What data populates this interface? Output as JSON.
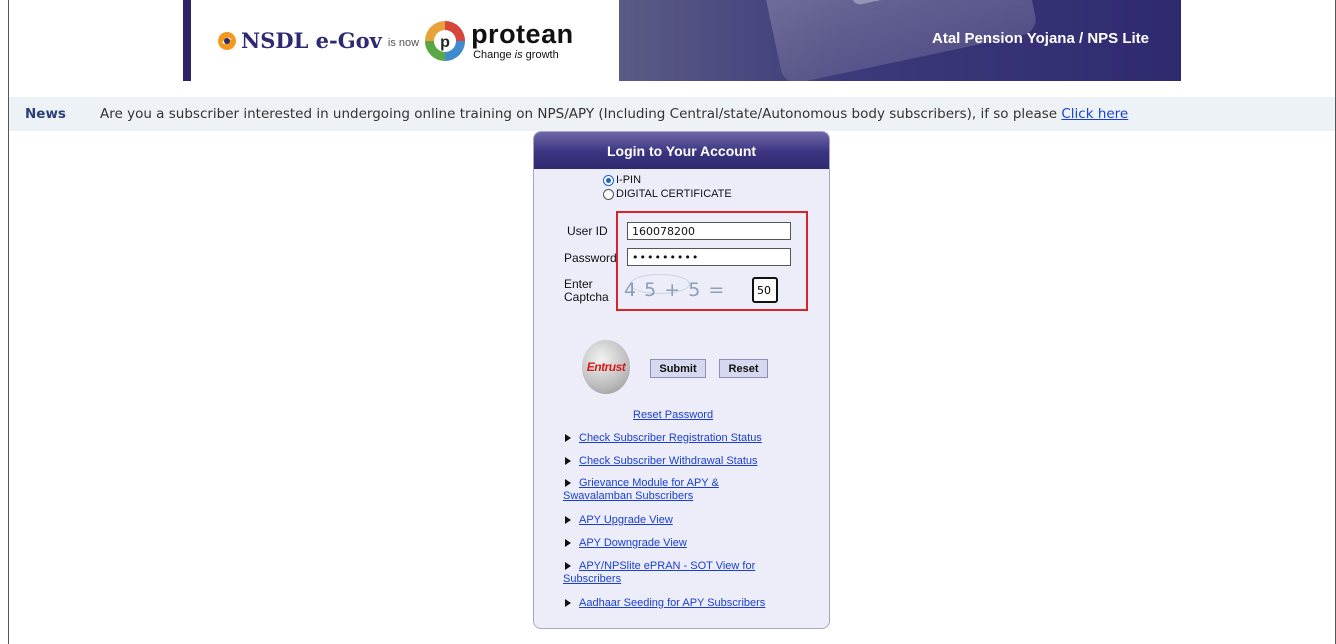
{
  "header": {
    "nsdl_logo_text": "NSDL e-Gov",
    "is_now_text": "is now",
    "protean_logo_text": "protean",
    "protean_tagline_pre": "Change ",
    "protean_tagline_italic": "is",
    "protean_tagline_post": " growth",
    "title": "Atal Pension Yojana / NPS Lite"
  },
  "news": {
    "label": "News",
    "text": "Are you a subscriber interested in undergoing online training on NPS/APY (Including Central/state/Autonomous body subscribers), if so please ",
    "link_text": "Click here"
  },
  "login": {
    "title": "Login to Your Account",
    "options": [
      {
        "label": "I-PIN",
        "selected": true
      },
      {
        "label": "DIGITAL CERTIFICATE",
        "selected": false
      }
    ],
    "user_id_label": "User ID",
    "user_id_value": "160078200",
    "password_label": "Password",
    "password_value": "•••••••••",
    "captcha_label_1": "Enter",
    "captcha_label_2": "Captcha",
    "captcha_expression": "4 5 + 5 =",
    "captcha_answer": "50",
    "seal_text": "Entrust",
    "submit_label": "Submit",
    "reset_label": "Reset",
    "reset_password_link": "Reset Password"
  },
  "links": [
    {
      "line1": "Check Subscriber Registration Status",
      "line2": ""
    },
    {
      "line1": "Check Subscriber Withdrawal Status",
      "line2": ""
    },
    {
      "line1": "Grievance Module for APY &",
      "line2": "Swavalamban Subscribers"
    },
    {
      "line1": "APY Upgrade View",
      "line2": ""
    },
    {
      "line1": "APY Downgrade View",
      "line2": ""
    },
    {
      "line1": "APY/NPSlite ePRAN - SOT View for",
      "line2": "Subscribers"
    },
    {
      "line1": "Aadhaar Seeding for APY Subscribers",
      "line2": ""
    }
  ],
  "colors": {
    "brand_navy": "#2f2a70",
    "highlight_red": "#d9232a",
    "link_blue": "#1a3fd0"
  }
}
